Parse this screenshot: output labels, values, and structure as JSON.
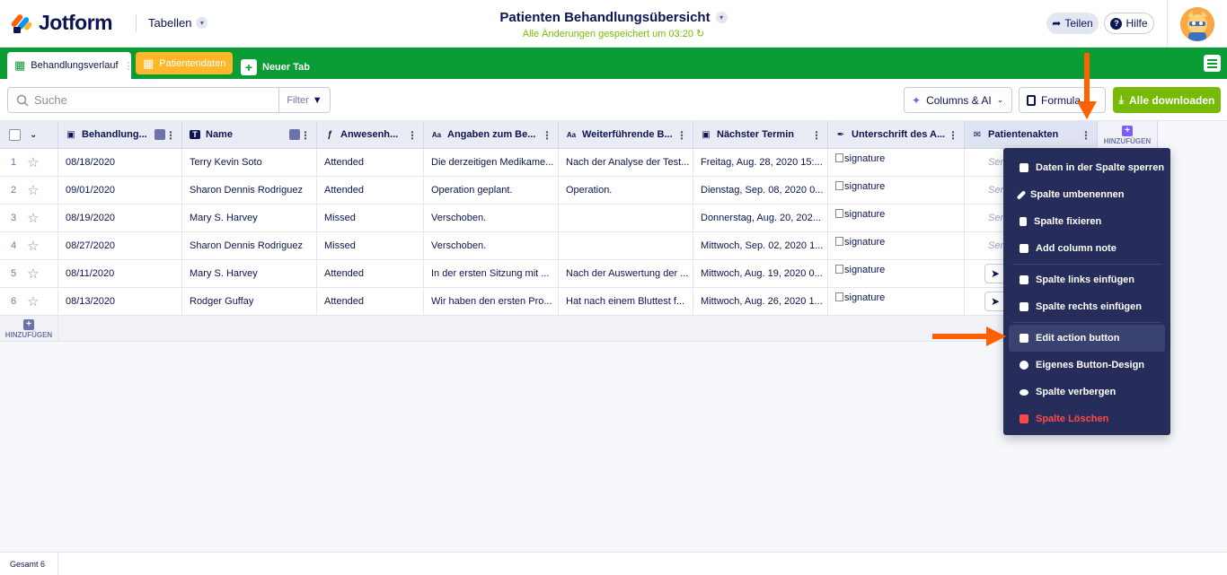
{
  "app": {
    "name": "Jotform",
    "tables_label": "Tabellen"
  },
  "header": {
    "title": "Patienten Behandlungsübersicht",
    "saved_status": "Alle Änderungen gespeichert um 03:20",
    "share_label": "Teilen",
    "help_label": "Hilfe"
  },
  "tabs": [
    {
      "label": "Behandlungsverlauf"
    },
    {
      "label": "Patientendaten"
    },
    {
      "label": "Neuer Tab"
    }
  ],
  "toolbar": {
    "search_placeholder": "Suche",
    "filter_label": "Filter",
    "columns_ai_label": "Columns & AI",
    "formula_label": "Formula",
    "download_label": "Alle downloaden"
  },
  "columns": [
    {
      "label": "Behandlung...",
      "icon": "calendar-icon"
    },
    {
      "label": "Name",
      "icon": "text-icon"
    },
    {
      "label": "Anwesenh...",
      "icon": "formula-icon"
    },
    {
      "label": "Angaben zum Be...",
      "icon": "aa-icon"
    },
    {
      "label": "Weiterführende B...",
      "icon": "aa-icon"
    },
    {
      "label": "Nächster Termin",
      "icon": "calendar-icon"
    },
    {
      "label": "Unterschrift des A...",
      "icon": "pen-icon"
    },
    {
      "label": "Patientenakten",
      "icon": "mail-icon"
    }
  ],
  "add_column_label": "HINZUFÜGEN",
  "rows": [
    {
      "num": "1",
      "date": "08/18/2020",
      "name": "Terry Kevin Soto",
      "attendance": "Attended",
      "details": "Die derzeitigen Medikame...",
      "further": "Nach der Analyse der Test...",
      "next": "Freitag, Aug. 28, 2020 15:...",
      "sig": "signature",
      "action": "Ser"
    },
    {
      "num": "2",
      "date": "09/01/2020",
      "name": "Sharon Dennis Rodriguez",
      "attendance": "Attended",
      "details": "Operation geplant.",
      "further": "Operation.",
      "next": "Dienstag, Sep. 08, 2020 0...",
      "sig": "signature",
      "action": "Ser"
    },
    {
      "num": "3",
      "date": "08/19/2020",
      "name": "Mary S. Harvey",
      "attendance": "Missed",
      "details": "Verschoben.",
      "further": "",
      "next": "Donnerstag, Aug. 20, 202...",
      "sig": "signature",
      "action": "Ser"
    },
    {
      "num": "4",
      "date": "08/27/2020",
      "name": "Sharon Dennis Rodriguez",
      "attendance": "Missed",
      "details": "Verschoben.",
      "further": "",
      "next": "Mittwoch, Sep. 02, 2020 1...",
      "sig": "signature",
      "action": "Ser"
    },
    {
      "num": "5",
      "date": "08/11/2020",
      "name": "Mary S. Harvey",
      "attendance": "Attended",
      "details": "In der ersten Sitzung mit ...",
      "further": "Nach der Auswertung der ...",
      "next": "Mittwoch, Aug. 19, 2020 0...",
      "sig": "signature",
      "action": ""
    },
    {
      "num": "6",
      "date": "08/13/2020",
      "name": "Rodger Guffay",
      "attendance": "Attended",
      "details": "Wir haben den ersten Pro...",
      "further": "Hat nach einem Bluttest f...",
      "next": "Mittwoch, Aug. 26, 2020 1...",
      "sig": "signature",
      "action": ""
    }
  ],
  "add_row_label": "HINZUFÜGEN",
  "footer": {
    "total_label": "Gesamt 6"
  },
  "context_menu": [
    {
      "label": "Daten in der Spalte sperren",
      "icon": "lock-icon"
    },
    {
      "label": "Spalte umbenennen",
      "icon": "pencil-icon"
    },
    {
      "label": "Spalte fixieren",
      "icon": "pin-icon"
    },
    {
      "label": "Add column note",
      "icon": "note-icon"
    },
    {
      "label": "Spalte links einfügen",
      "icon": "insert-left-icon"
    },
    {
      "label": "Spalte rechts einfügen",
      "icon": "insert-right-icon"
    },
    {
      "label": "Edit action button",
      "icon": "edit-button-icon"
    },
    {
      "label": "Eigenes Button-Design",
      "icon": "palette-icon"
    },
    {
      "label": "Spalte verbergen",
      "icon": "eye-off-icon"
    },
    {
      "label": "Spalte Löschen",
      "icon": "trash-icon"
    }
  ],
  "colors": {
    "brand_green": "#0a9c35",
    "orange_tab": "#ffb629",
    "download_green": "#78bb07",
    "menu_bg": "#262d5a",
    "annotation_arrow": "#ff6100",
    "danger": "#ff4948"
  }
}
